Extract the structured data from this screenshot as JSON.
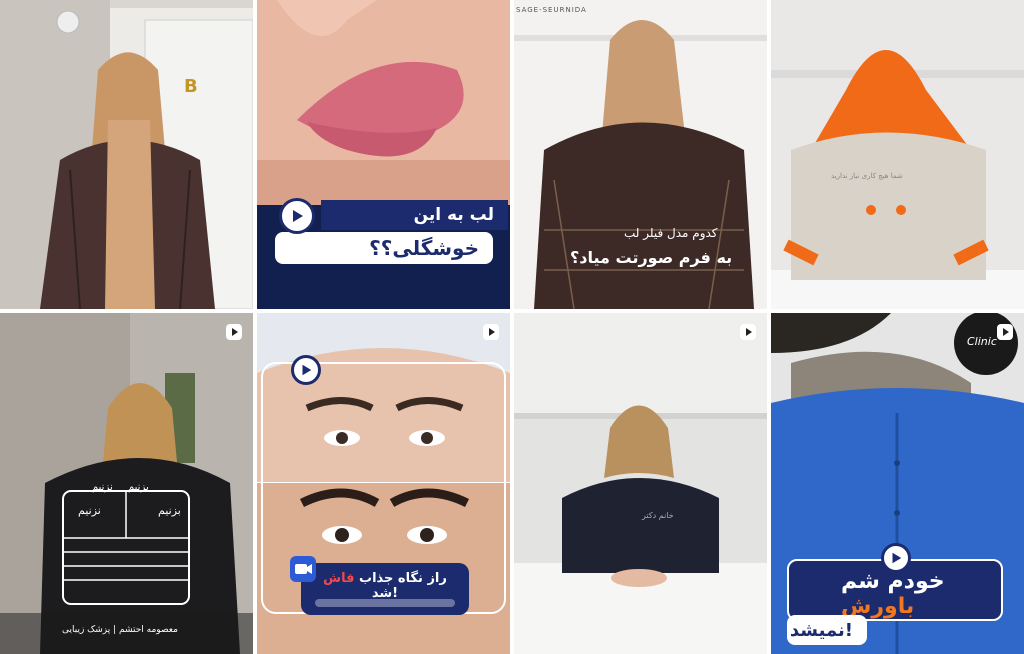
{
  "colors": {
    "accent_blue": "#1c2a6e",
    "accent_red": "#e0282c",
    "accent_orange": "#f0781e"
  },
  "tiles": [
    {
      "id": 1,
      "badge": "B"
    },
    {
      "id": 2,
      "caption_top": "لب به این",
      "caption_bottom": "خوشگلی؟؟"
    },
    {
      "id": 3,
      "logo_text": "SAGE-SEURNIDA",
      "caption_line1": "کدوم مدل فیلر لب",
      "caption_line2": "به فرم صورتت میاد؟"
    },
    {
      "id": 4,
      "caption": "شما هیچ کاری نیاز ندارید"
    },
    {
      "id": 5,
      "label_left": "بزنیم",
      "label_right": "نزنیم",
      "label_left2": "بزنیم",
      "label_right2": "نزنیم",
      "footer": "معصومه احتشم | پزشک زیبایی"
    },
    {
      "id": 6,
      "caption_part1": "راز نگاه جذاب",
      "caption_highlight": "فاش",
      "caption_part2": "شد!"
    },
    {
      "id": 7,
      "shirt_text": "خانم دکتر"
    },
    {
      "id": 8,
      "caption_line1_a": "خودم شم",
      "caption_line1_b": "باورش",
      "caption_line2": "نمیشد!",
      "logo_text": "Clinic"
    }
  ]
}
